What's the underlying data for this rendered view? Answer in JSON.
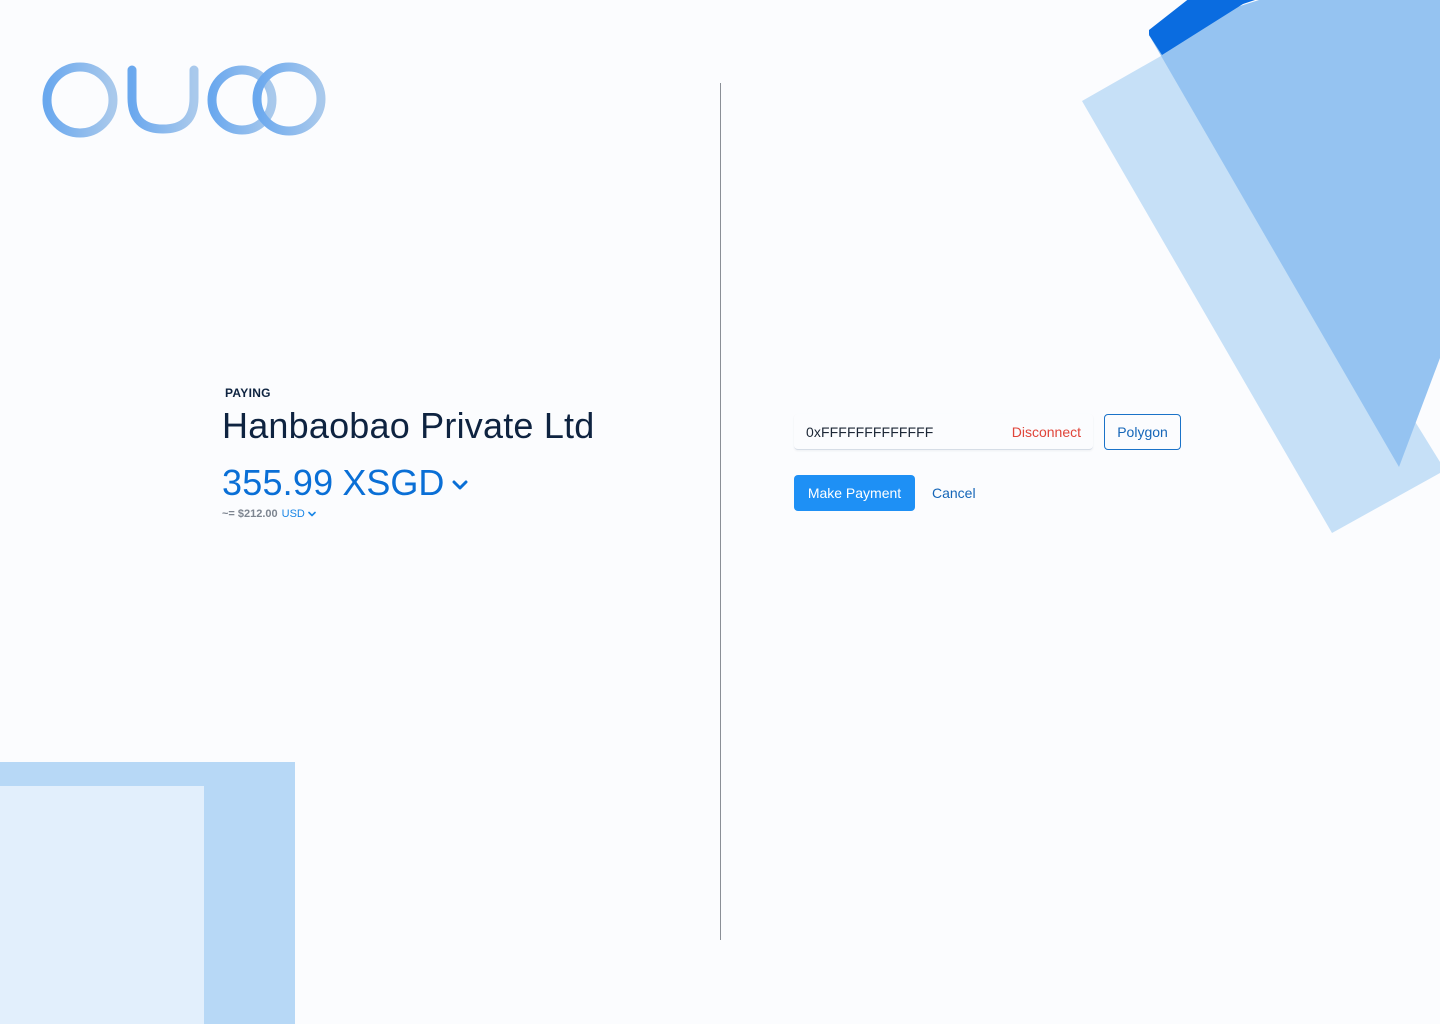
{
  "brand": {
    "logo_text": "qubo",
    "logo_color_start": "#6aa8ee",
    "logo_color_end": "#a9c9ec"
  },
  "payment": {
    "label": "PAYING",
    "merchant_name": "Hanbaobao Private Ltd",
    "amount": "355.99",
    "currency": "XSGD",
    "currency_dropdown_icon": "chevron-down-icon",
    "approx_prefix": "~=",
    "approx_value": "$212.00",
    "fiat_currency": "USD",
    "fiat_dropdown_icon": "chevron-down-icon"
  },
  "wallet": {
    "address": "0xFFFFFFFFFFFFF",
    "disconnect_label": "Disconnect",
    "network_label": "Polygon"
  },
  "actions": {
    "pay_label": "Make Payment",
    "cancel_label": "Cancel"
  },
  "colors": {
    "primary": "#1e90f5",
    "accent_text": "#0a6fd6",
    "danger": "#e0453a",
    "heading": "#0e2340",
    "deco_dark": "#0a6ce0",
    "deco_mid": "#95c3f1",
    "deco_light": "#c6e0f7"
  }
}
